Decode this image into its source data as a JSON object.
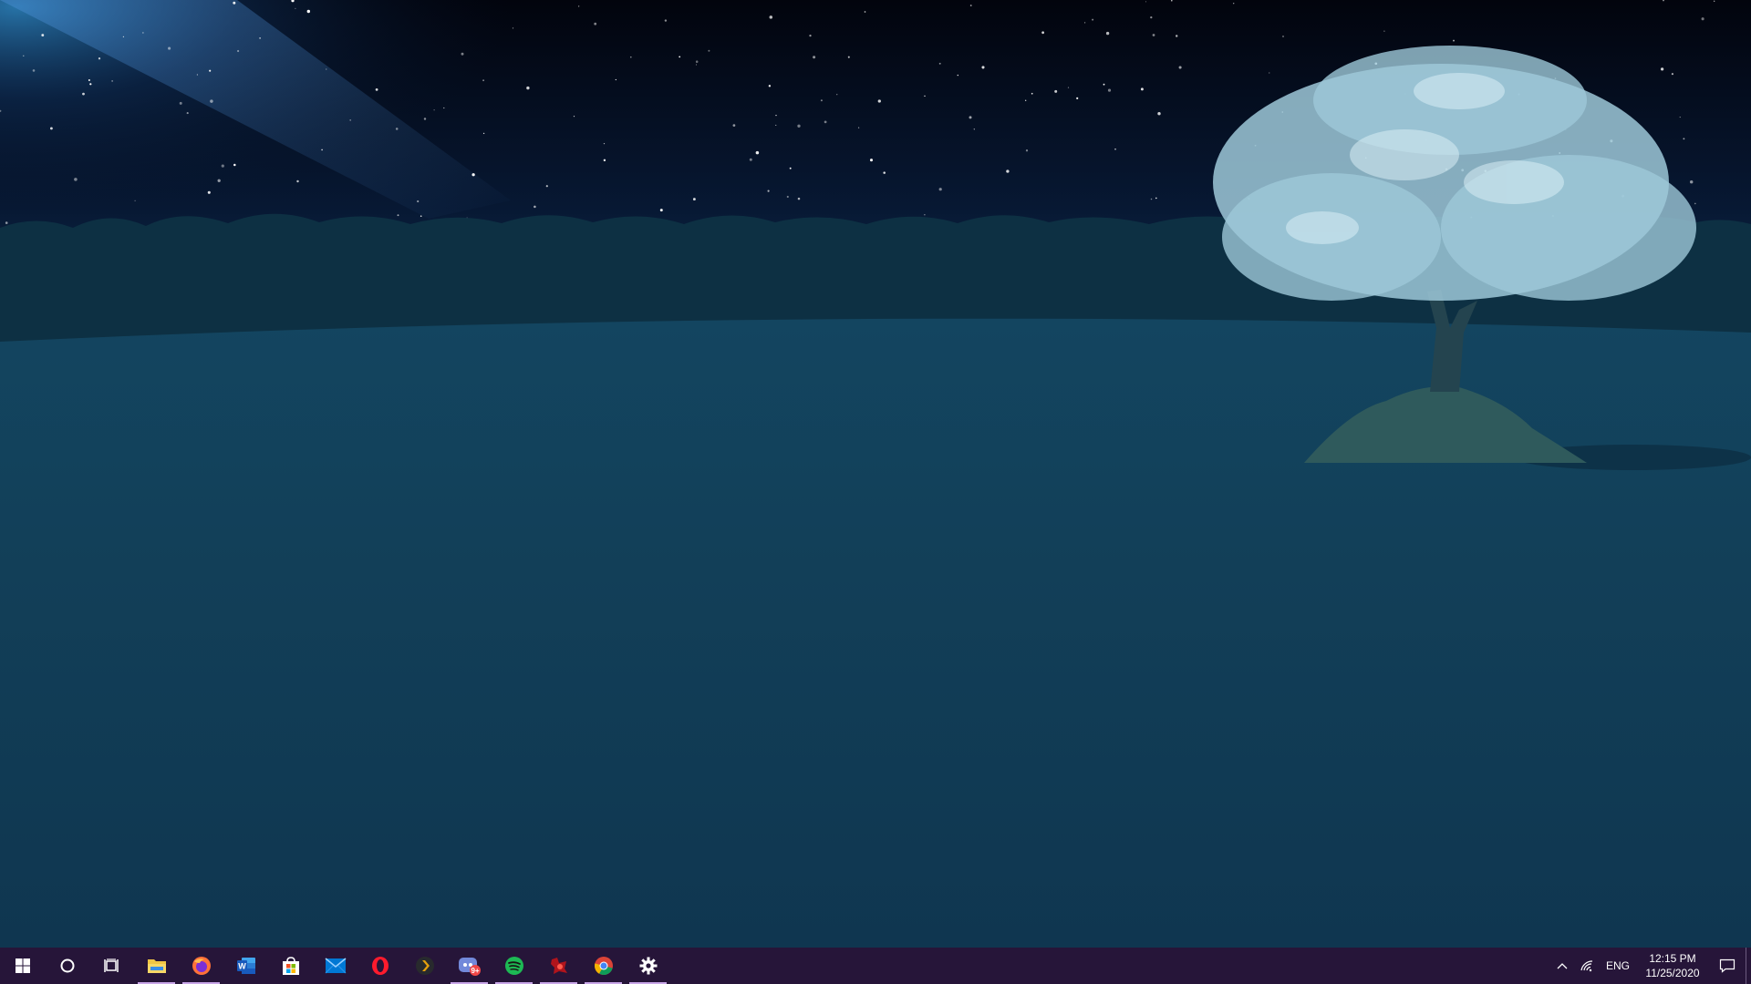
{
  "desktop": {
    "wallpaper": {
      "sky_top": "#02040d",
      "sky_horizon": "#0e3556",
      "field": "#123e58",
      "treeline": "#0d3043",
      "tree_blossom": "#9ec8d8"
    }
  },
  "taskbar": {
    "background": "#261539",
    "indicator": "#c9a6e8",
    "items": [
      {
        "key": "start",
        "icon": "windows-logo-icon",
        "running": false
      },
      {
        "key": "search",
        "icon": "cortana-circle-icon",
        "running": false
      },
      {
        "key": "task-view",
        "icon": "task-view-icon",
        "running": false
      },
      {
        "key": "file-explorer",
        "icon": "folder-icon",
        "running": true
      },
      {
        "key": "firefox",
        "icon": "firefox-icon",
        "running": true
      },
      {
        "key": "word",
        "icon": "word-icon",
        "running": false
      },
      {
        "key": "store",
        "icon": "store-bag-icon",
        "running": false
      },
      {
        "key": "mail",
        "icon": "mail-envelope-icon",
        "running": false
      },
      {
        "key": "opera",
        "icon": "opera-icon",
        "running": false
      },
      {
        "key": "plex",
        "icon": "plex-chevron-icon",
        "running": false
      },
      {
        "key": "discord",
        "icon": "discord-icon",
        "running": true,
        "badge": "9+"
      },
      {
        "key": "spotify",
        "icon": "spotify-icon",
        "running": true
      },
      {
        "key": "game-launcher",
        "icon": "red-app-icon",
        "running": true
      },
      {
        "key": "chrome",
        "icon": "chrome-icon",
        "running": true
      },
      {
        "key": "settings",
        "icon": "gear-icon",
        "running": true
      }
    ]
  },
  "tray": {
    "chevron_icon": "chevron-up-icon",
    "network_icon": "wifi-icon",
    "language": "ENG",
    "time": "12:15 PM",
    "date": "11/25/2020",
    "notifications_icon": "action-center-icon"
  }
}
